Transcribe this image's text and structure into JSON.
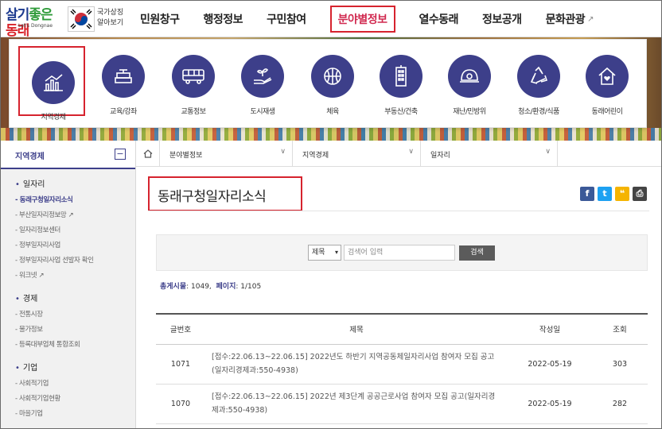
{
  "header": {
    "logo_text": "살기좋은동래",
    "logo_sub": "Let's Dongnae",
    "national_symbol": [
      "국가상징",
      "알아보기"
    ],
    "menu": [
      {
        "label": "민원창구"
      },
      {
        "label": "행정정보"
      },
      {
        "label": "구민참여"
      },
      {
        "label": "분야별정보",
        "active": true
      },
      {
        "label": "열수동래"
      },
      {
        "label": "정보공개"
      },
      {
        "label": "문화관광",
        "external": true
      }
    ]
  },
  "mega_menu": [
    {
      "label": "지역경제",
      "icon": "chart-icon",
      "selected": true
    },
    {
      "label": "교육/강좌",
      "icon": "books-icon"
    },
    {
      "label": "교통정보",
      "icon": "bus-icon"
    },
    {
      "label": "도시재생",
      "icon": "hand-plant-icon"
    },
    {
      "label": "체육",
      "icon": "ball-icon"
    },
    {
      "label": "부동산/건축",
      "icon": "building-icon"
    },
    {
      "label": "재난/민방위",
      "icon": "helmet-icon"
    },
    {
      "label": "청소/환경/식품",
      "icon": "recycle-icon"
    },
    {
      "label": "동래어린이",
      "icon": "house-heart-icon"
    }
  ],
  "sidebar": {
    "title": "지역경제",
    "toggle": "−",
    "groups": [
      {
        "label": "일자리",
        "items": [
          {
            "label": "- 동래구청일자리소식",
            "active": true
          },
          {
            "label": "- 부산일자리정보망 ↗"
          },
          {
            "label": "- 일자리정보센터"
          },
          {
            "label": "- 정부일자리사업"
          },
          {
            "label": "- 정부일자리사업 선발자 확인"
          },
          {
            "label": "- 워크넷 ↗"
          }
        ]
      },
      {
        "label": "경제",
        "items": [
          {
            "label": "- 전통시장"
          },
          {
            "label": "- 물가정보"
          },
          {
            "label": "- 등록대부업체 통합조회"
          }
        ]
      },
      {
        "label": "기업",
        "items": [
          {
            "label": "- 사회적기업"
          },
          {
            "label": "- 사회적기업현황"
          },
          {
            "label": "- 마을기업"
          }
        ]
      }
    ]
  },
  "breadcrumb": [
    "분야별정보",
    "지역경제",
    "일자리"
  ],
  "page": {
    "title": "동래구청일자리소식",
    "share": [
      {
        "icon": "facebook-icon",
        "glyph": "f",
        "color": "#3b5998"
      },
      {
        "icon": "twitter-icon",
        "glyph": "t",
        "color": "#1da1f2"
      },
      {
        "icon": "kakaostory-icon",
        "glyph": "❝",
        "color": "#f5b400"
      },
      {
        "icon": "print-icon",
        "glyph": "⎙",
        "color": "#444444"
      }
    ]
  },
  "search": {
    "select_value": "제목",
    "placeholder": "검색어 입력",
    "button": "검색"
  },
  "count": {
    "total_label": "총게시물",
    "total_value": ": 1049,",
    "page_label": "페이지",
    "page_value": ": 1/105"
  },
  "table": {
    "columns": [
      "글번호",
      "제목",
      "작성일",
      "조회"
    ],
    "rows": [
      {
        "no": "1071",
        "title": "[접수:22.06.13~22.06.15] 2022년도 하반기 지역공동체일자리사업 참여자 모집 공고(일자리경제과:550-4938)",
        "date": "2022-05-19",
        "views": "303"
      },
      {
        "no": "1070",
        "title": "[접수:22.06.13~22.06.15] 2022년 제3단계 공공근로사업 참여자 모집 공고(일자리경제과:550-4938)",
        "date": "2022-05-19",
        "views": "282"
      }
    ]
  }
}
